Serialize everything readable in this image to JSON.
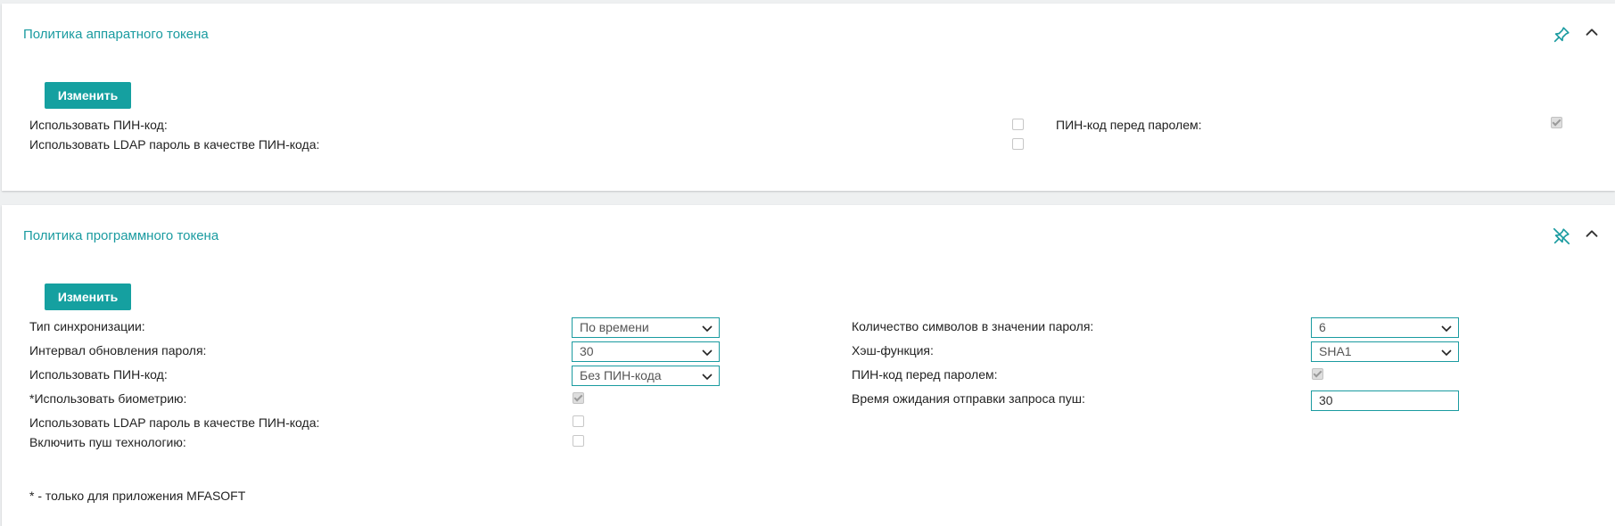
{
  "hardware_policy": {
    "title": "Политика аппаратного токена",
    "edit_label": "Изменить",
    "fields": {
      "use_pin_label": "Использовать ПИН-код:",
      "use_pin_checked": false,
      "use_ldap_label": "Использовать LDAP пароль в качестве ПИН-кода:",
      "use_ldap_checked": false,
      "pin_before_password_label": "ПИН-код перед паролем:",
      "pin_before_password_checked": true
    }
  },
  "software_policy": {
    "title": "Политика программного токена",
    "edit_label": "Изменить",
    "fields": {
      "sync_type_label": "Тип синхронизации:",
      "sync_type_value": "По времени",
      "refresh_interval_label": "Интервал обновления пароля:",
      "refresh_interval_value": "30",
      "use_pin_label": "Использовать ПИН-код:",
      "use_pin_value": "Без ПИН-кода",
      "use_biometry_label": "*Использовать биометрию:",
      "use_biometry_checked": true,
      "use_ldap_label": "Использовать LDAP пароль в качестве ПИН-кода:",
      "use_ldap_checked": false,
      "enable_push_label": "Включить пуш технологию:",
      "enable_push_checked": false,
      "password_length_label": "Количество символов в значении пароля:",
      "password_length_value": "6",
      "hash_function_label": "Хэш-функция:",
      "hash_function_value": "SHA1",
      "pin_before_password_label": "ПИН-код перед паролем:",
      "pin_before_password_checked": true,
      "push_timeout_label": "Время ожидания отправки запроса пуш:",
      "push_timeout_value": "30"
    },
    "footnote": "* - только для приложения MFASOFT"
  },
  "colors": {
    "accent": "#1a9ba0",
    "button": "#15a0a0",
    "background": "#eef0f1"
  },
  "icons": {
    "pin": "pin-icon",
    "unpin": "pin-off-icon",
    "collapse": "chevron-up-icon"
  }
}
